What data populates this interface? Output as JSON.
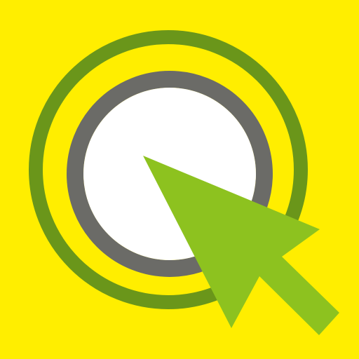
{
  "icon": {
    "name": "click-target-cursor-icon",
    "colors": {
      "background": "#FFEE00",
      "outer_ring": "#6A961A",
      "inner_ring": "#6B6B67",
      "center_fill": "#FFFFFF",
      "cursor": "#8DC21F"
    }
  }
}
